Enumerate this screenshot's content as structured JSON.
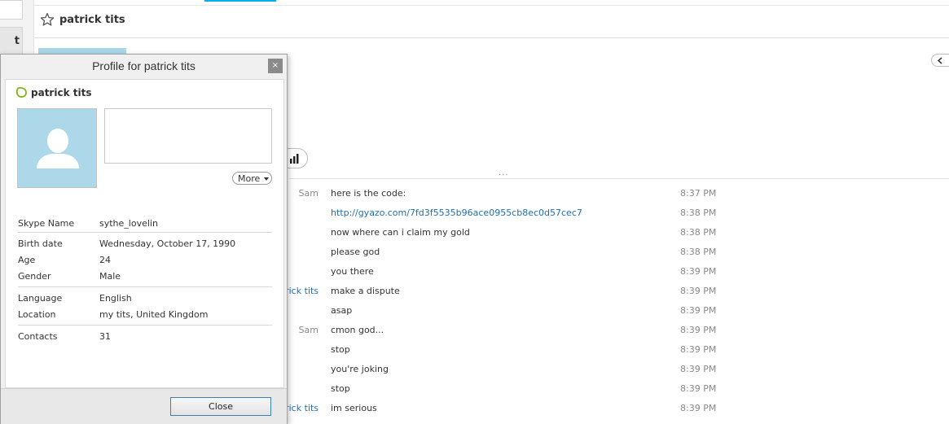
{
  "conversation": {
    "title": "patrick tits"
  },
  "left_nav": {
    "label_fragment": "t"
  },
  "toolbar": {
    "ellipsis": "..."
  },
  "messages": [
    {
      "sender": "Sam",
      "text": "here is the code:",
      "time": "8:37 PM",
      "link": false
    },
    {
      "sender": "",
      "text": "http://gyazo.com/7fd3f5535b96ace0955cb8ec0d57cec7",
      "time": "8:38 PM",
      "link": true
    },
    {
      "sender": "",
      "text": "now where can i claim my gold",
      "time": "8:38 PM",
      "link": false
    },
    {
      "sender": "",
      "text": "please god",
      "time": "8:38 PM",
      "link": false
    },
    {
      "sender": "",
      "text": "you there",
      "time": "8:39 PM",
      "link": false
    },
    {
      "sender": "rick tits",
      "text": "make a dispute",
      "time": "8:39 PM",
      "link": false
    },
    {
      "sender": "",
      "text": "asap",
      "time": "8:39 PM",
      "link": false
    },
    {
      "sender": "Sam",
      "text": "cmon god...",
      "time": "8:39 PM",
      "link": false
    },
    {
      "sender": "",
      "text": "stop",
      "time": "8:39 PM",
      "link": false
    },
    {
      "sender": "",
      "text": "you're joking",
      "time": "8:39 PM",
      "link": false
    },
    {
      "sender": "",
      "text": "stop",
      "time": "8:39 PM",
      "link": false
    },
    {
      "sender": "rick tits",
      "text": "im serious",
      "time": "8:39 PM",
      "link": false
    }
  ],
  "profile_dialog": {
    "title": "Profile for patrick tits",
    "close_x": "×",
    "name": "patrick tits",
    "more_label": "More",
    "fields": {
      "skype_name": {
        "label": "Skype Name",
        "value": "sythe_lovelin"
      },
      "birth_date": {
        "label": "Birth date",
        "value": "Wednesday, October 17, 1990"
      },
      "age": {
        "label": "Age",
        "value": "24"
      },
      "gender": {
        "label": "Gender",
        "value": "Male"
      },
      "language": {
        "label": "Language",
        "value": "English"
      },
      "location": {
        "label": "Location",
        "value": "my tits, United Kingdom"
      },
      "contacts": {
        "label": "Contacts",
        "value": "31"
      }
    },
    "close_button": "Close"
  },
  "colors": {
    "accent": "#00aff0",
    "link": "#1f6fb2",
    "avatar_bg": "#add8e9",
    "status_green": "#7cb518"
  }
}
